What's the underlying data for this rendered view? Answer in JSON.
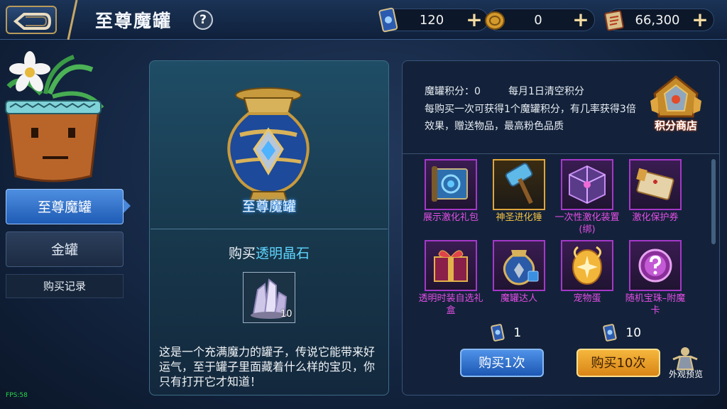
{
  "header": {
    "title": "至尊魔罐",
    "help_label": "?",
    "resources": [
      {
        "icon": "card-icon",
        "value": "120",
        "plus": "+"
      },
      {
        "icon": "coin-icon",
        "value": "0",
        "plus": "+"
      },
      {
        "icon": "scroll-icon",
        "value": "66,300",
        "plus": "+"
      }
    ]
  },
  "nav": {
    "items": [
      {
        "label": "至尊魔罐",
        "active": true
      },
      {
        "label": "金罐",
        "active": false
      }
    ],
    "record_label": "购买记录"
  },
  "center": {
    "jar_name": "至尊魔罐",
    "buy_prefix": "购买",
    "buy_item": "透明晶石",
    "item_count": "10",
    "description": "这是一个充满魔力的罐子，传说它能带来好运气，至于罐子里面藏着什么样的宝贝，你只有打开它才知道！"
  },
  "right": {
    "points_label": "魔罐积分：0",
    "clear_note": "每月1日清空积分",
    "rules": "每购买一次可获得1个魔罐积分，有几率获得3倍效果，赠送物品，最高粉色品质",
    "shop_label": "积分商店",
    "items": [
      {
        "name": "展示激化礼包",
        "icon": "scroll-gift-icon",
        "quality": "purple"
      },
      {
        "name": "神圣进化锤",
        "icon": "hammer-icon",
        "quality": "gold"
      },
      {
        "name": "一次性激化装置(绑)",
        "icon": "cube-device-icon",
        "quality": "purple"
      },
      {
        "name": "激化保护券",
        "icon": "ticket-icon",
        "quality": "purple"
      },
      {
        "name": "透明时装自选礼盒",
        "icon": "gift-box-icon",
        "quality": "purple"
      },
      {
        "name": "魔罐达人",
        "icon": "jar-master-icon",
        "quality": "purple"
      },
      {
        "name": "宠物蛋",
        "icon": "pet-egg-icon",
        "quality": "purple"
      },
      {
        "name": "随机宝珠–附魔卡",
        "icon": "mystery-orb-icon",
        "quality": "purple"
      }
    ],
    "cost_single": "1",
    "cost_ten": "10",
    "buy_one_label": "购买1次",
    "buy_ten_label": "购买10次",
    "preview_label": "外观预览"
  },
  "debug": {
    "fps": "FPS:58"
  },
  "colors": {
    "accent_blue": "#1f5bb5",
    "gold": "#f0c043",
    "purple_quality": "#e54ee6",
    "cyan_text": "#5fd6ff"
  }
}
